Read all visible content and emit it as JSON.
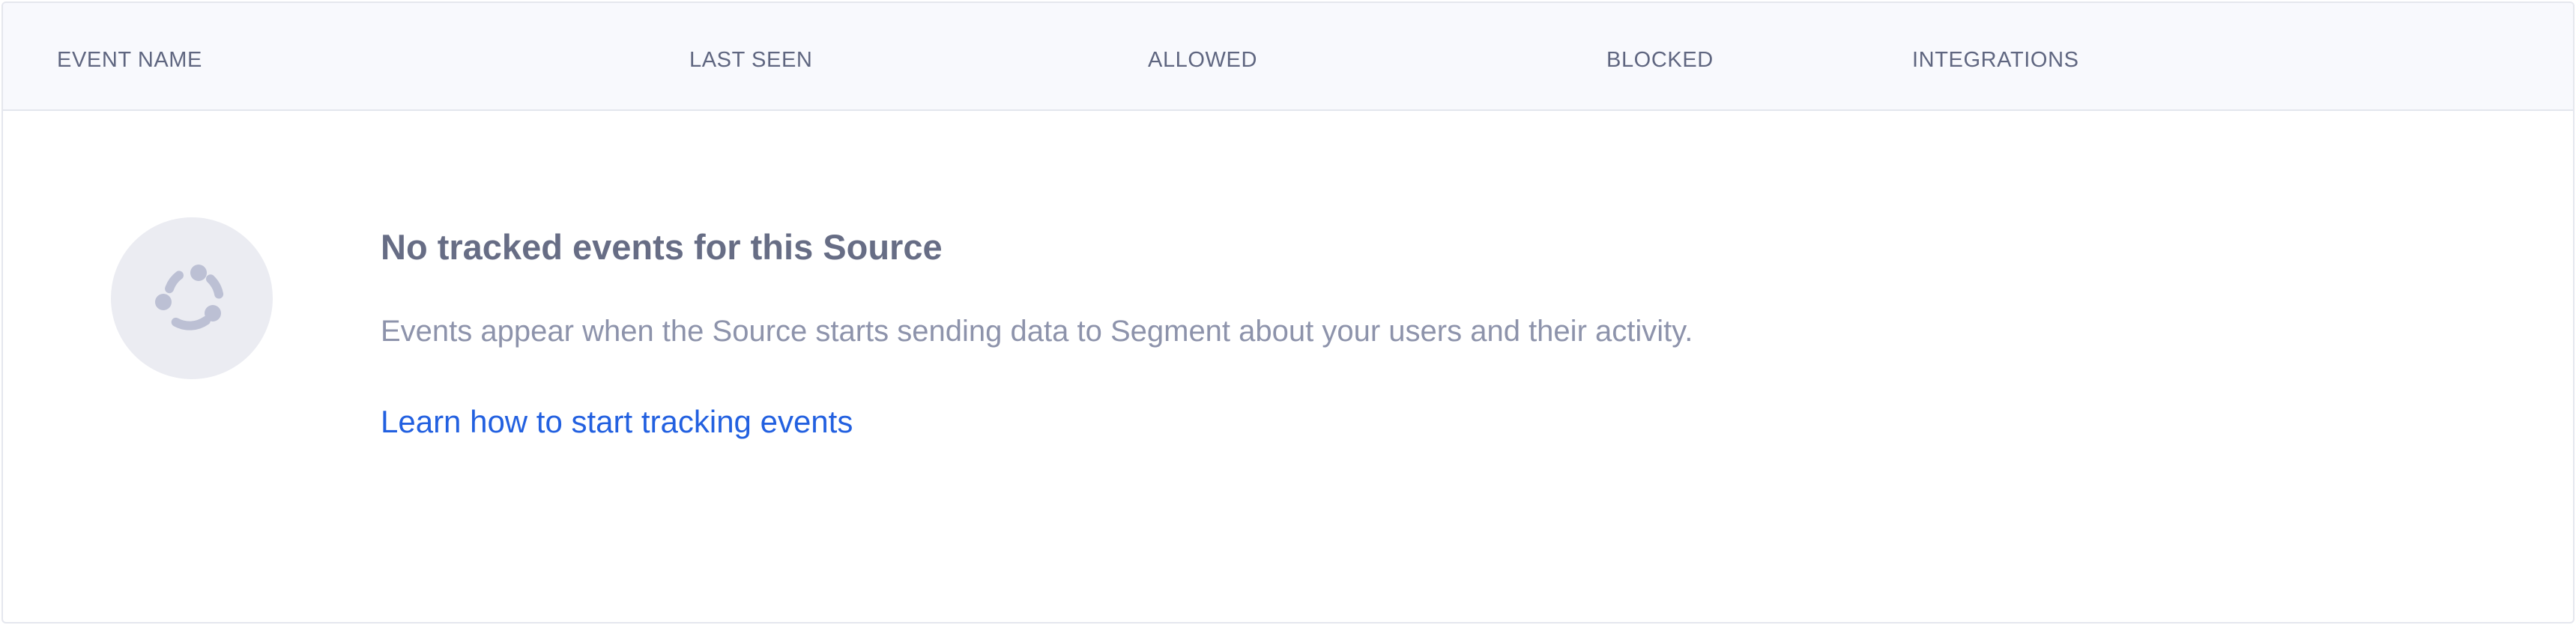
{
  "table": {
    "columns": [
      "EVENT NAME",
      "LAST SEEN",
      "ALLOWED",
      "BLOCKED",
      "INTEGRATIONS"
    ]
  },
  "empty_state": {
    "icon": "events-cycle-icon",
    "title": "No tracked events for this Source",
    "description": "Events appear when the Source starts sending data to Segment about your users and their activity.",
    "link_label": "Learn how to start tracking events"
  },
  "colors": {
    "header_background": "#f8f9fd",
    "title_text": "#676d85",
    "description_text": "#8d93ab",
    "link": "#2260e0",
    "icon_circle": "#ebecf2",
    "icon_stroke": "#bcc0d4"
  }
}
